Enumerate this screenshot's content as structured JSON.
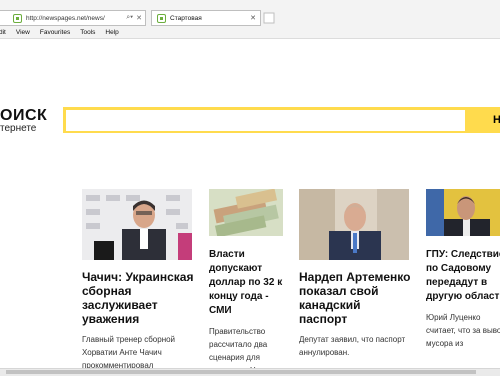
{
  "browser": {
    "url": "http://newspages.net/news/",
    "tab_title": "Стартовая",
    "menu": [
      "dit",
      "View",
      "Favourites",
      "Tools",
      "Help"
    ]
  },
  "search": {
    "logo_top": "ОИСК",
    "logo_bottom": "тернете",
    "query": "",
    "button_label": "Н"
  },
  "news": [
    {
      "title": "Чачич: Украинская сборная заслуживает уважения",
      "text": "Главный тренер сборной Хорватии Анте Чачич прокомментировал"
    },
    {
      "title": "Власти допускают доллар по 32 к концу года - СМИ",
      "text": "Правительство рассчитало два сценария для экономики Украины"
    },
    {
      "title": "Нардеп Артеменко показал свой канадский паспорт",
      "text": "Депутат заявил, что паспорт аннулирован."
    },
    {
      "title": "ГПУ: Следствие по Садовому передадут в другую область",
      "text": "Юрий Луценко считает, что за вывоз мусора из"
    }
  ],
  "colors": {
    "search_border": "#ffdb4d",
    "favicon": "#6cae3e"
  }
}
